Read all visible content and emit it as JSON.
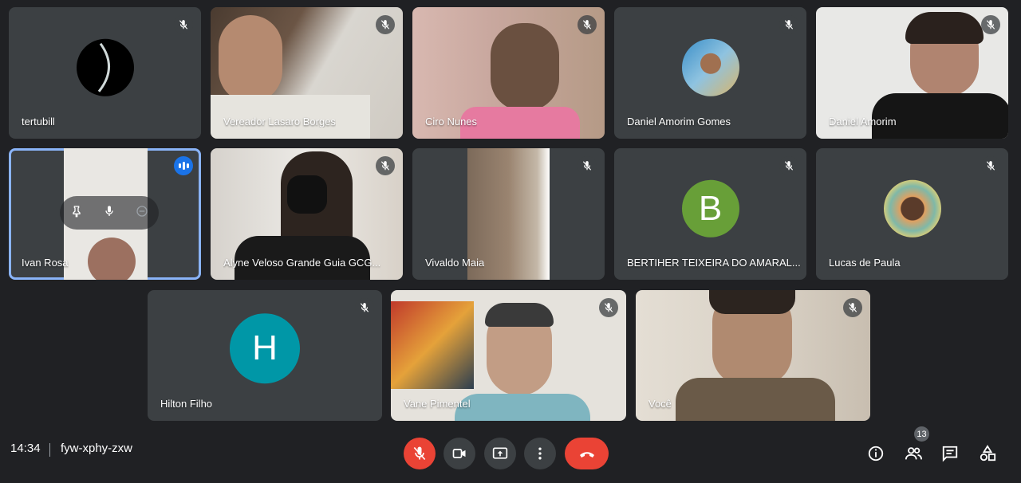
{
  "participants": [
    {
      "name": "tertubill"
    },
    {
      "name": "Vereador Lasaro Borges"
    },
    {
      "name": "Ciro Nunes"
    },
    {
      "name": "Daniel Amorim Gomes"
    },
    {
      "name": "Daniel Amorim"
    },
    {
      "name": "Ivan Rosa"
    },
    {
      "name": "Alyne Veloso Grande Guia GCG..."
    },
    {
      "name": "Vivaldo Maia"
    },
    {
      "name": "BERTIHER TEIXEIRA DO AMARAL..."
    },
    {
      "name": "Lucas de Paula"
    },
    {
      "name": "Hilton Filho",
      "initial": "H"
    },
    {
      "name": "Vane Pimentel"
    },
    {
      "name": "Você"
    }
  ],
  "bertiher_initial": "B",
  "meeting": {
    "time": "14:34",
    "code": "fyw-xphy-zxw",
    "participant_count": "13"
  },
  "colors": {
    "background": "#202124",
    "tile": "#3c4043",
    "accent_blue": "#1a73e8",
    "end_call_red": "#ea4335",
    "avatar_b": "#689f38",
    "avatar_h": "#0097a7"
  },
  "icons": [
    "mic-off-icon",
    "camera-icon",
    "present-icon",
    "more-options-icon",
    "end-call-icon",
    "info-icon",
    "people-icon",
    "chat-icon",
    "activities-icon",
    "pin-icon",
    "mic-icon",
    "remove-icon"
  ]
}
